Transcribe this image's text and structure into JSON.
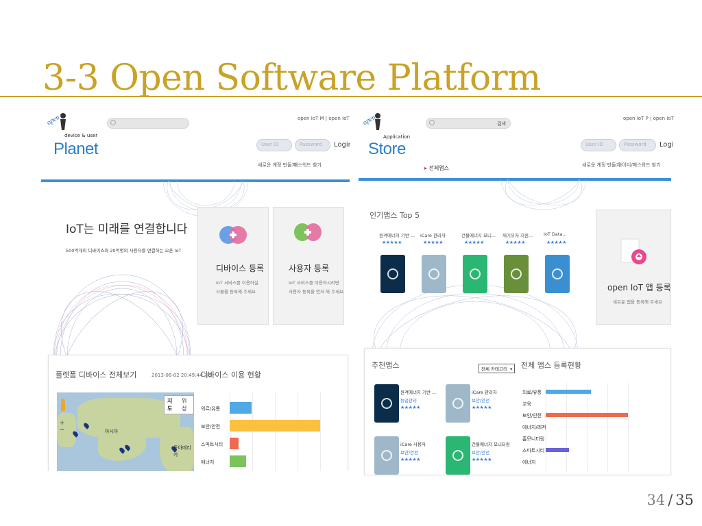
{
  "slide": {
    "title": "3-3 Open Software Platform",
    "page_current": "34",
    "page_sep": "/",
    "page_total": "35"
  },
  "planet": {
    "logo_open": "open",
    "logo_sub": "device & user",
    "logo_main": "Planet",
    "top_links": "open IoT M | open IoT S",
    "user_id_placeholder": "User ID",
    "password_placeholder": "Password",
    "login_label": "Login",
    "signup_link": "새로운 계정 만들기",
    "find_password_link": "패스워드 찾기",
    "hero_title": "IoT는 미래를 연결합니다",
    "hero_subtitle": "500억개의 디바이스와 20억명의 사용자를 연결하는 오픈 IoT",
    "device_card": {
      "title": "디바이스 등록",
      "desc_line1": "IoT 서비스를 이용하실",
      "desc_line2": "사물을 등록해 주세요"
    },
    "user_card": {
      "title": "사용자 등록",
      "desc_line1": "IoT 서비스를 이용하시려면",
      "desc_line2": "사용자 등록을 먼저 해 주세요"
    },
    "panel_title": "플랫폼 디바이스 전체보기",
    "timestamp": "2013-06-02 20:49:44 기준",
    "map_toggle": [
      "지도",
      "위성"
    ],
    "map_labels": [
      "아시아",
      "동아메리카"
    ],
    "usage_title": "디바이스 이용 현황",
    "usage_chart": {
      "categories": [
        "의료/유통",
        "보안/안전",
        "스마트시티",
        "에너지"
      ],
      "values": [
        24,
        100,
        10,
        18
      ],
      "colors": [
        "#4ea9e6",
        "#fbc13c",
        "#f06a4f",
        "#7dc35b"
      ]
    }
  },
  "store": {
    "logo_open": "open",
    "logo_sub": "Application",
    "logo_main": "Store",
    "search_label": "검색",
    "top_links": "open IoT P | open IoT M",
    "user_id_placeholder": "User ID",
    "password_placeholder": "Password",
    "login_label": "Login",
    "signup_link": "새로운 계정 만들기",
    "find_password_link": "아이디/패스워드 찾기",
    "nav_all_apps": "전체앱스",
    "top5_title": "인기앱스 Top 5",
    "top5": [
      {
        "name": "원격에너지 기반 ...",
        "stars": "★★★★★",
        "icon": "power-icon",
        "color": "#0b2d4a"
      },
      {
        "name": "iCare 관리자",
        "stars": "★★★★★",
        "icon": "icare-icon",
        "color": "#9fb8c9"
      },
      {
        "name": "건물에너지 모니...",
        "stars": "★★★★★",
        "icon": "energy-icon",
        "color": "#2bb673"
      },
      {
        "name": "재기유저 지원...",
        "stars": "★★★★★",
        "icon": "sensor-icon",
        "color": "#6a8f3a"
      },
      {
        "name": "IoT Data...",
        "stars": "★★★★★",
        "icon": "mashup-icon",
        "color": "#3a8fd0"
      }
    ],
    "register_card": {
      "title": "open IoT 앱 등록",
      "subtitle": "새로운 앱을 등록해 주세요"
    },
    "recommended_title": "추천앱스",
    "category_dropdown": "전체 카테고리",
    "recommended": [
      {
        "name": "원격에너지 기반 ...",
        "category": "농업관리",
        "stars": "★★★★★",
        "icon": "power-icon",
        "color": "#0b2d4a"
      },
      {
        "name": "iCare 관리자",
        "category": "보안/안전",
        "stars": "★★★★★",
        "icon": "icare-icon",
        "color": "#9fb8c9"
      },
      {
        "name": "iCare 사용자",
        "category": "보안/안전",
        "stars": "★★★★★",
        "icon": "icare-icon",
        "color": "#9fb8c9"
      },
      {
        "name": "건물에너지 모니터링",
        "category": "보안/안전",
        "stars": "★★★★★",
        "icon": "energy-icon",
        "color": "#2bb673"
      }
    ],
    "reg_status_title": "전체 앱스 등록현황",
    "reg_chart": {
      "categories": [
        "의료/유통",
        "교육",
        "보안/안전",
        "에너지/레저",
        "홈모니터링",
        "스마트시티",
        "에너지"
      ],
      "values": [
        55,
        0,
        100,
        0,
        0,
        28,
        0
      ],
      "colors": [
        "#4ea9e6",
        "#4ea9e6",
        "#f06a4f",
        "#7dc35b",
        "#7dc35b",
        "#6a62d9",
        "#7dc35b"
      ]
    }
  }
}
